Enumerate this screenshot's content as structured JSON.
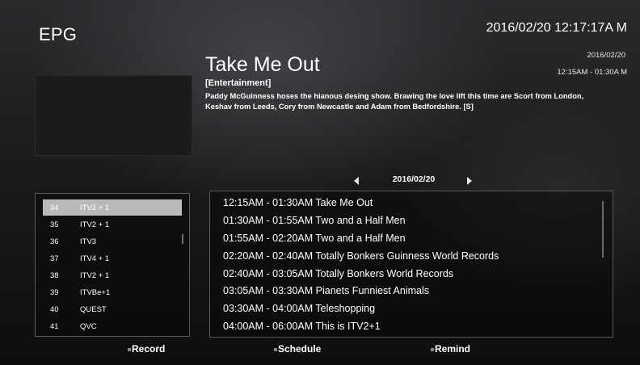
{
  "header": {
    "title": "EPG",
    "clock": "2016/02/20 12:17:17A  M"
  },
  "program": {
    "title": "Take Me Out",
    "date": "2016/02/20",
    "time": "12:15AM - 01:30A  M",
    "genre": "[Entertainment]",
    "description": "Paddy McGuinness hoses the hianous desing show.  Brawing the love lift this time are Scort from London, Keshav from Leeds, Cory from Newcastle and Adam from Bedfordshire. [S]"
  },
  "date_nav": {
    "date": "2016/02/20"
  },
  "channels": [
    {
      "number": "34",
      "name": "ITV2 + 1",
      "selected": true
    },
    {
      "number": "35",
      "name": "ITV2 + 1",
      "selected": false
    },
    {
      "number": "36",
      "name": "ITV3",
      "selected": false
    },
    {
      "number": "37",
      "name": "ITV4 + 1",
      "selected": false
    },
    {
      "number": "38",
      "name": "ITV2 + 1",
      "selected": false
    },
    {
      "number": "39",
      "name": "ITVBe+1",
      "selected": false
    },
    {
      "number": "40",
      "name": "QUEST",
      "selected": false
    },
    {
      "number": "41",
      "name": "QVC",
      "selected": false
    }
  ],
  "schedule": [
    "12:15AM - 01:30AM Take Me Out",
    "01:30AM - 01:55AM Two and a Half Men",
    "01:55AM - 02:20AM Two and a Half Men",
    "02:20AM - 02:40AM Totally Bonkers Guinness World Records",
    "02:40AM - 03:05AM Totally Bonkers World Records",
    "03:05AM - 03:30AM Pianets Funniest Animals",
    "03:30AM - 04:00AM Teleshopping",
    "04:00AM - 06:00AM This is ITV2+1"
  ],
  "footer": {
    "record": "Record",
    "schedule": "Schedule",
    "remind": "Remind"
  },
  "icons": {
    "prev_date": "triangle-left-icon",
    "next_date": "triangle-right-icon"
  },
  "colors": {
    "selected_row": "#b9b9b9",
    "panel_border": "#5a5a5a",
    "text": "#ffffff"
  }
}
